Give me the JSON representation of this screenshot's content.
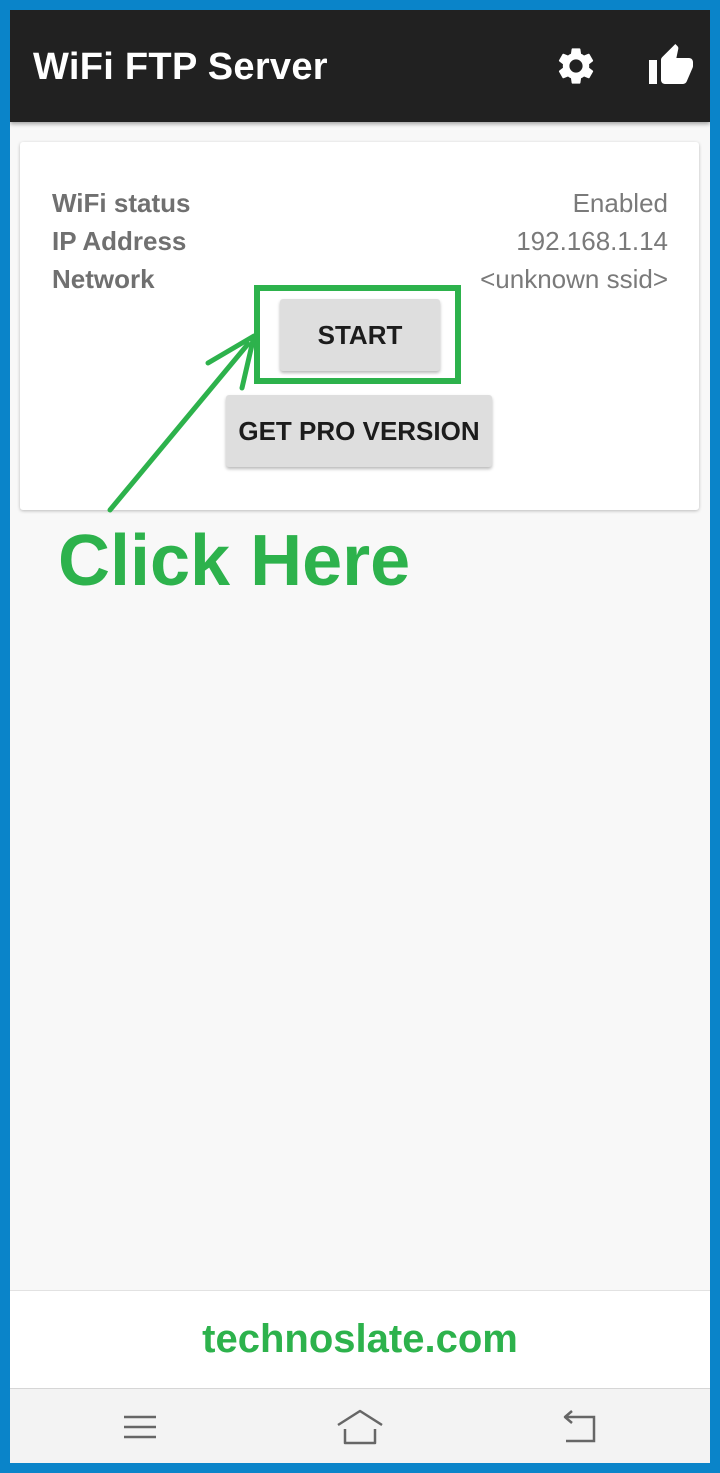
{
  "toolbar": {
    "title": "WiFi FTP Server",
    "icons": [
      "gear-icon",
      "thumbs-up-icon"
    ]
  },
  "status": {
    "rows": [
      {
        "label": "WiFi status",
        "value": "Enabled"
      },
      {
        "label": "IP Address",
        "value": "192.168.1.14"
      },
      {
        "label": "Network",
        "value": "<unknown ssid>"
      }
    ]
  },
  "buttons": {
    "start": "START",
    "pro": "GET PRO VERSION"
  },
  "annotation": {
    "text": "Click Here",
    "color": "#2db24c"
  },
  "footer": {
    "site": "technoslate.com"
  },
  "navbar": {
    "icons": [
      "menu-icon",
      "home-icon",
      "back-icon"
    ]
  },
  "colors": {
    "toolbar": "#212121",
    "border": "#0a84c9",
    "accent": "#2db24c"
  }
}
